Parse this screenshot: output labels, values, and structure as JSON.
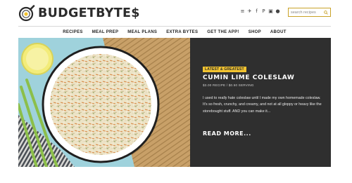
{
  "brand": {
    "name": "BUDGETBYTE$"
  },
  "social": [
    {
      "icon": "rss-icon",
      "glyph": "≡"
    },
    {
      "icon": "twitter-icon",
      "glyph": "✈"
    },
    {
      "icon": "facebook-icon",
      "glyph": "f"
    },
    {
      "icon": "pinterest-icon",
      "glyph": "P"
    },
    {
      "icon": "instagram-icon",
      "glyph": "▣"
    },
    {
      "icon": "user-icon",
      "glyph": "●"
    }
  ],
  "search": {
    "placeholder": "search recipes"
  },
  "nav": [
    "RECIPES",
    "MEAL PREP",
    "MEAL PLANS",
    "EXTRA BYTES",
    "GET THE APP!",
    "SHOP",
    "ABOUT"
  ],
  "feature": {
    "badge": "LATEST & GREATEST",
    "title": "CUMIN LIME COLESLAW",
    "meta": "$3.00 RECIPE / $0.50 SERVING",
    "excerpt": "I used to really hate coleslaw until I made my own homemade coleslaw. It's so fresh, crunchy, and creamy, and not at all gloppy or heavy like the storebought stuff. AND you can make it...",
    "more": "READ MORE..."
  },
  "colors": {
    "accent": "#f3c430",
    "panel": "#2f2f2f",
    "search_border": "#c9a227"
  }
}
